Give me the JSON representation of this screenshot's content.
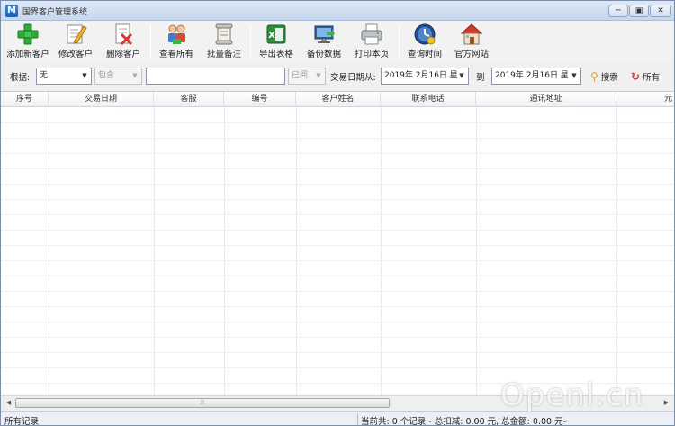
{
  "window": {
    "title": "国界客户管理系统",
    "icon_letter": "M",
    "min": "─",
    "max": "▣",
    "close": "✕"
  },
  "toolbar": {
    "items": [
      {
        "label": "添加新客户",
        "icon": "add-plus-icon"
      },
      {
        "label": "修改客户",
        "icon": "edit-pencil-icon"
      },
      {
        "label": "删除客户",
        "icon": "delete-doc-icon"
      },
      {
        "label": "查看所有",
        "icon": "view-all-people-icon"
      },
      {
        "label": "批量备注",
        "icon": "batch-note-scroll-icon"
      },
      {
        "label": "导出表格",
        "icon": "excel-export-icon"
      },
      {
        "label": "备份数据",
        "icon": "backup-monitor-icon"
      },
      {
        "label": "打印本页",
        "icon": "printer-icon"
      },
      {
        "label": "查询时间",
        "icon": "clock-globe-icon"
      },
      {
        "label": "官方网站",
        "icon": "home-website-icon"
      }
    ]
  },
  "search": {
    "by_label": "根据:",
    "by_value": "无",
    "field_value": "包含",
    "keyword": "",
    "type_value": "已阅",
    "date_from_label": "交易日期从:",
    "date_from": "2019年 2月16日 星",
    "to_label": "到",
    "date_to": "2019年 2月16日 星",
    "search_label": "搜索",
    "all_label": "所有"
  },
  "grid": {
    "columns": [
      "序号",
      "交易日期",
      "客服",
      "编号",
      "客户姓名",
      "联系电话",
      "通讯地址",
      "元"
    ]
  },
  "status": {
    "left": "所有记录",
    "right": "当前共: 0 个记录 - 总扣减: 0.00 元, 总金额: 0.00 元-"
  },
  "watermark": "Openl.cn",
  "colors": {
    "accent": "#1c5fb0",
    "green": "#2fa83a",
    "red": "#d23a2a"
  }
}
